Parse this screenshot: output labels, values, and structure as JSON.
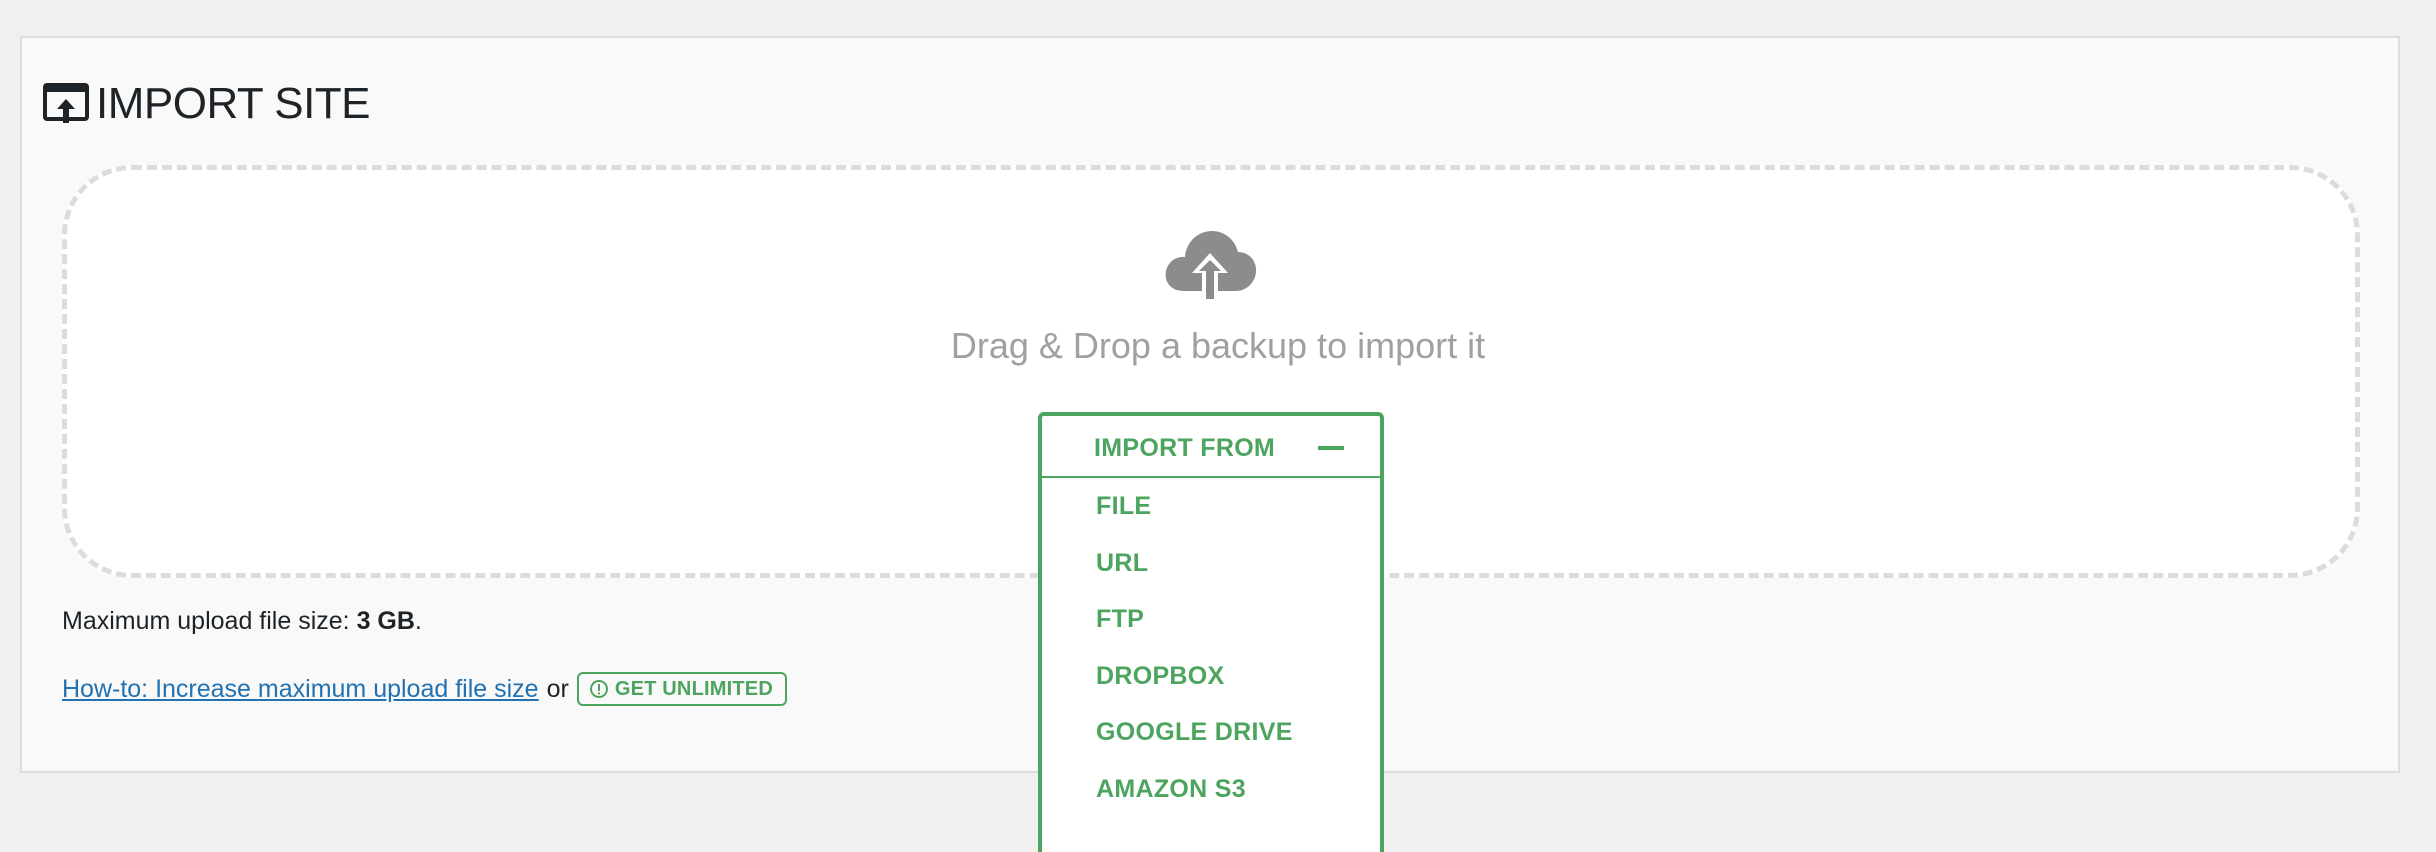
{
  "header": {
    "title": "IMPORT SITE"
  },
  "dropzone": {
    "text": "Drag & Drop a backup to import it"
  },
  "import_dropdown": {
    "label": "IMPORT FROM",
    "items": [
      "FILE",
      "URL",
      "FTP",
      "DROPBOX",
      "GOOGLE DRIVE",
      "AMAZON S3"
    ]
  },
  "limits": {
    "prefix": "Maximum upload file size: ",
    "value": "3 GB",
    "suffix": "."
  },
  "help": {
    "link_text": "How-to: Increase maximum upload file size",
    "or_text": "or",
    "unlimited_label": "GET UNLIMITED"
  },
  "colors": {
    "accent": "#4da45f",
    "link": "#2271b1",
    "muted_text": "#a0a0a0",
    "panel_bg": "#f9f9f9",
    "page_bg": "#f0f0f1"
  },
  "icons": {
    "title": "import-window-icon",
    "dropzone": "cloud-upload-icon",
    "collapse": "minus-icon",
    "alert": "alert-circle-icon"
  }
}
